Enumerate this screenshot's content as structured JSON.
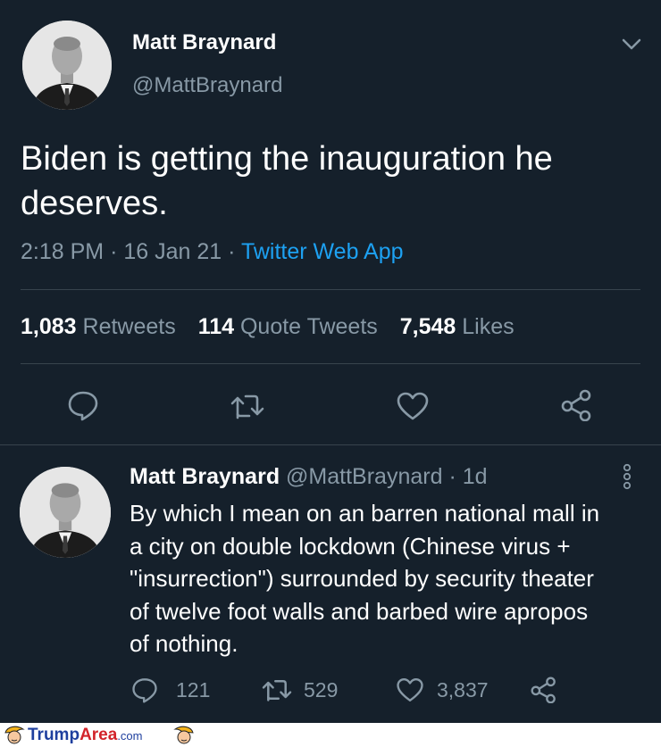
{
  "tweet": {
    "author_name": "Matt Braynard",
    "author_handle": "@MattBraynard",
    "text_line1": "Biden is getting the inauguration he",
    "text_line2": "deserves.",
    "time": "2:18 PM",
    "sep1": "·",
    "date": "16 Jan 21",
    "sep2": "·",
    "source": "Twitter Web App",
    "stats": {
      "retweets_count": "1,083",
      "retweets_label": "Retweets",
      "quotes_count": "114",
      "quotes_label": "Quote Tweets",
      "likes_count": "7,548",
      "likes_label": "Likes"
    },
    "icons": {
      "menu": "chevron-down-icon",
      "reply": "reply-icon",
      "retweet": "retweet-icon",
      "like": "heart-icon",
      "share": "share-icon"
    }
  },
  "reply": {
    "author_name": "Matt Braynard",
    "author_handle": "@MattBraynard",
    "sep": "·",
    "age": "1d",
    "lines": [
      "By which I mean on an barren national mall in",
      "a city on double lockdown (Chinese virus +",
      "\"insurrection\") surrounded by security theater",
      "of twelve foot walls and barbed wire apropos",
      "of nothing."
    ],
    "reply_count": "121",
    "retweet_count": "529",
    "like_count": "3,837"
  },
  "footer": {
    "brand_trump": "Trump",
    "brand_area": "Area",
    "brand_tld": ".com"
  },
  "colors": {
    "background": "#15202b",
    "accent": "#1da1f2",
    "muted": "#8899a6",
    "divider": "#38444d",
    "brand_blue": "#1e3f9e",
    "brand_red": "#d2232a"
  }
}
